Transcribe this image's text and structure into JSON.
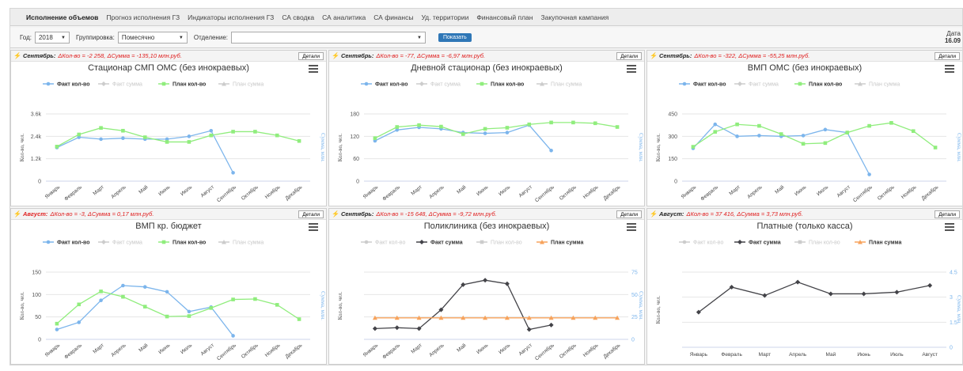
{
  "nav": {
    "items": [
      "Исполнение объемов",
      "Прогноз исполнения ГЗ",
      "Индикаторы исполнения ГЗ",
      "СА сводка",
      "СА аналитика",
      "СА финансы",
      "Уд. территории",
      "Финансовый план",
      "Закупочная кампания"
    ]
  },
  "filters": {
    "year_label": "Год:",
    "year_value": "2018",
    "group_label": "Группировка:",
    "group_value": "Помесячно",
    "dept_label": "Отделение:",
    "dept_value": "",
    "show_button": "Показать",
    "date_label": "Дата",
    "date_value": "16.09"
  },
  "colors": {
    "fact": "#7cb5ec",
    "plan": "#90ed7d",
    "fact_sum": "#434348",
    "plan_sum": "#f7a35c",
    "hidden": "#cccccc",
    "alert": "#e02020"
  },
  "panels": [
    {
      "month": "Сентябрь:",
      "month_color": "#222",
      "delta": "ΔКол-во = -2 258, ΔСумма = -135,10 млн.руб.",
      "delta_color": "#e02020",
      "detail": "Детали"
    },
    {
      "month": "Сентябрь:",
      "month_color": "#222",
      "delta": "ΔКол-во = -77, ΔСумма = -6,97 млн.руб.",
      "delta_color": "#e02020",
      "detail": "Детали"
    },
    {
      "month": "Сентябрь:",
      "month_color": "#222",
      "delta": "ΔКол-во = -322, ΔСумма = -55,25 млн.руб.",
      "delta_color": "#e02020",
      "detail": "Детали"
    },
    {
      "month": "Август:",
      "month_color": "#e02020",
      "delta": "ΔКол-во = -3, ΔСумма = 0,17 млн.руб.",
      "delta_color": "#e02020",
      "detail": "Детали"
    },
    {
      "month": "Сентябрь:",
      "month_color": "#222",
      "delta": "ΔКол-во = -15 648, ΔСумма = -9,72 млн.руб.",
      "delta_color": "#e02020",
      "detail": "Детали"
    },
    {
      "month": "Август:",
      "month_color": "#222",
      "delta": "ΔКол-во = 37 416, ΔСумма = 3,73 млн.руб.",
      "delta_color": "#e02020",
      "detail": "Детали"
    }
  ],
  "chart_data": [
    {
      "type": "line",
      "title": "Стационар СМП ОМС (без инокраевых)",
      "ylabel": "Кол-во, чел.",
      "y2label": "Сумма, млн.",
      "ylim": [
        0,
        3600
      ],
      "yticks": [
        0,
        1200,
        2400,
        3600
      ],
      "ytick_labels": [
        "0",
        "1.2k",
        "2.4k",
        "3.6k"
      ],
      "categories": [
        "Январь",
        "Февраль",
        "Март",
        "Апрель",
        "Май",
        "Июнь",
        "Июль",
        "Август",
        "Сентябрь",
        "Октябрь",
        "Ноябрь",
        "Декабрь"
      ],
      "legend": [
        {
          "name": "Факт кол-во",
          "color": "#7cb5ec",
          "marker": "circle",
          "active": true
        },
        {
          "name": "Факт сумма",
          "color": "#cccccc",
          "marker": "diamond",
          "active": false
        },
        {
          "name": "План кол-во",
          "color": "#90ed7d",
          "marker": "square",
          "active": true
        },
        {
          "name": "План сумма",
          "color": "#cccccc",
          "marker": "triangle",
          "active": false
        }
      ],
      "series": [
        {
          "name": "Факт кол-во",
          "color": "#7cb5ec",
          "marker": "circle",
          "values": [
            1800,
            2350,
            2250,
            2300,
            2250,
            2250,
            2400,
            2700,
            450
          ]
        },
        {
          "name": "План кол-во",
          "color": "#90ed7d",
          "marker": "square",
          "values": [
            1850,
            2500,
            2850,
            2700,
            2350,
            2100,
            2100,
            2450,
            2650,
            2650,
            2450,
            2150
          ]
        }
      ]
    },
    {
      "type": "line",
      "title": "Дневной стационар (без инокраевых)",
      "ylabel": "Кол-во, чел.",
      "y2label": "Сумма, млн.",
      "ylim": [
        0,
        180
      ],
      "yticks": [
        0,
        60,
        120,
        180
      ],
      "ytick_labels": [
        "0",
        "60",
        "120",
        "180"
      ],
      "categories": [
        "Январь",
        "Февраль",
        "Март",
        "Апрель",
        "Май",
        "Июнь",
        "Июль",
        "Август",
        "Сентябрь",
        "Октябрь",
        "Ноябрь",
        "Декабрь"
      ],
      "legend": [
        {
          "name": "Факт кол-во",
          "color": "#7cb5ec",
          "marker": "circle",
          "active": true
        },
        {
          "name": "Факт сумма",
          "color": "#cccccc",
          "marker": "diamond",
          "active": false
        },
        {
          "name": "План кол-во",
          "color": "#90ed7d",
          "marker": "square",
          "active": true
        },
        {
          "name": "План сумма",
          "color": "#cccccc",
          "marker": "triangle",
          "active": false
        }
      ],
      "series": [
        {
          "name": "Факт кол-во",
          "color": "#7cb5ec",
          "marker": "circle",
          "values": [
            108,
            137,
            144,
            140,
            130,
            128,
            130,
            150,
            82
          ]
        },
        {
          "name": "План кол-во",
          "color": "#90ed7d",
          "marker": "square",
          "values": [
            115,
            145,
            150,
            146,
            126,
            140,
            143,
            152,
            157,
            157,
            155,
            145
          ]
        }
      ]
    },
    {
      "type": "line",
      "title": "ВМП ОМС (без инокраевых)",
      "ylabel": "Кол-во, чел.",
      "y2label": "Сумма, млн.",
      "ylim": [
        0,
        450
      ],
      "yticks": [
        0,
        150,
        300,
        450
      ],
      "ytick_labels": [
        "0",
        "150",
        "300",
        "450"
      ],
      "categories": [
        "Январь",
        "Февраль",
        "Март",
        "Апрель",
        "Май",
        "Июнь",
        "Июль",
        "Август",
        "Сентябрь",
        "Октябрь",
        "Ноябрь",
        "Декабрь"
      ],
      "legend": [
        {
          "name": "Факт кол-во",
          "color": "#7cb5ec",
          "marker": "circle",
          "active": true
        },
        {
          "name": "Факт сумма",
          "color": "#cccccc",
          "marker": "diamond",
          "active": false
        },
        {
          "name": "План кол-во",
          "color": "#90ed7d",
          "marker": "square",
          "active": true
        },
        {
          "name": "План сумма",
          "color": "#cccccc",
          "marker": "triangle",
          "active": false
        }
      ],
      "series": [
        {
          "name": "Факт кол-во",
          "color": "#7cb5ec",
          "marker": "circle",
          "values": [
            220,
            380,
            300,
            305,
            300,
            305,
            345,
            325,
            45
          ]
        },
        {
          "name": "План кол-во",
          "color": "#90ed7d",
          "marker": "square",
          "values": [
            230,
            330,
            380,
            370,
            315,
            250,
            255,
            325,
            370,
            390,
            335,
            225
          ]
        }
      ]
    },
    {
      "type": "line",
      "title": "ВМП кр. бюджет",
      "ylabel": "Кол-во, чел.",
      "y2label": "Сумма, млн.",
      "ylim": [
        0,
        150
      ],
      "yticks": [
        0,
        50,
        100,
        150
      ],
      "ytick_labels": [
        "0",
        "50",
        "100",
        "150"
      ],
      "categories": [
        "Январь",
        "Февраль",
        "Март",
        "Апрель",
        "Май",
        "Июнь",
        "Июль",
        "Август",
        "Сентябрь",
        "Октябрь",
        "Ноябрь",
        "Декабрь"
      ],
      "legend": [
        {
          "name": "Факт кол-во",
          "color": "#7cb5ec",
          "marker": "circle",
          "active": true
        },
        {
          "name": "Факт сумма",
          "color": "#cccccc",
          "marker": "diamond",
          "active": false
        },
        {
          "name": "План кол-во",
          "color": "#90ed7d",
          "marker": "square",
          "active": true
        },
        {
          "name": "План сумма",
          "color": "#cccccc",
          "marker": "triangle",
          "active": false
        }
      ],
      "series": [
        {
          "name": "Факт кол-во",
          "color": "#7cb5ec",
          "marker": "circle",
          "values": [
            22,
            38,
            87,
            120,
            117,
            106,
            62,
            72,
            8
          ]
        },
        {
          "name": "План кол-во",
          "color": "#90ed7d",
          "marker": "square",
          "values": [
            35,
            78,
            107,
            95,
            73,
            51,
            52,
            70,
            89,
            90,
            77,
            45
          ]
        }
      ]
    },
    {
      "type": "line",
      "title": "Поликлиника (без инокраевых)",
      "ylabel": "Кол-во, чел.",
      "y2label": "Сумма, млн.",
      "ylim": [
        0,
        75
      ],
      "yticks": [
        0,
        25,
        50,
        75
      ],
      "ytick_labels": [
        "0",
        "25",
        "50",
        "75"
      ],
      "categories": [
        "Январь",
        "Февраль",
        "Март",
        "Апрель",
        "Май",
        "Июнь",
        "Июль",
        "Август",
        "Сентябрь",
        "Октябрь",
        "Ноябрь",
        "Декабрь"
      ],
      "legend": [
        {
          "name": "Факт кол-во",
          "color": "#cccccc",
          "marker": "circle",
          "active": false
        },
        {
          "name": "Факт сумма",
          "color": "#434348",
          "marker": "diamond",
          "active": true
        },
        {
          "name": "План кол-во",
          "color": "#cccccc",
          "marker": "square",
          "active": false
        },
        {
          "name": "План сумма",
          "color": "#f7a35c",
          "marker": "triangle",
          "active": true
        }
      ],
      "series": [
        {
          "name": "Факт сумма",
          "color": "#434348",
          "marker": "diamond",
          "values": [
            12,
            13,
            12,
            33,
            61,
            66,
            62,
            11,
            16
          ]
        },
        {
          "name": "План сумма",
          "color": "#f7a35c",
          "marker": "triangle",
          "values": [
            24,
            24,
            24,
            24,
            24,
            24,
            24,
            24,
            24,
            24,
            24,
            24
          ]
        }
      ]
    },
    {
      "type": "line",
      "title": "Платные (только касса)",
      "ylabel": "Кол-во, чел.",
      "y2label": "Сумма, млн.",
      "ylim": [
        0,
        4.5
      ],
      "yticks": [
        0,
        1.5,
        3,
        4.5
      ],
      "ytick_labels": [
        "0",
        "1.5",
        "3",
        "4.5"
      ],
      "categories": [
        "Январь",
        "Февраль",
        "Март",
        "Апрель",
        "Май",
        "Июнь",
        "Июль",
        "Август"
      ],
      "legend": [
        {
          "name": "Факт кол-во",
          "color": "#cccccc",
          "marker": "circle",
          "active": false
        },
        {
          "name": "Факт сумма",
          "color": "#434348",
          "marker": "diamond",
          "active": true
        },
        {
          "name": "План кол-во",
          "color": "#cccccc",
          "marker": "square",
          "active": false
        },
        {
          "name": "План сумма",
          "color": "#f7a35c",
          "marker": "triangle",
          "active": true
        }
      ],
      "series": [
        {
          "name": "Факт сумма",
          "color": "#434348",
          "marker": "diamond",
          "values": [
            2.1,
            3.6,
            3.1,
            3.9,
            3.2,
            3.2,
            3.3,
            3.7
          ]
        }
      ]
    }
  ]
}
